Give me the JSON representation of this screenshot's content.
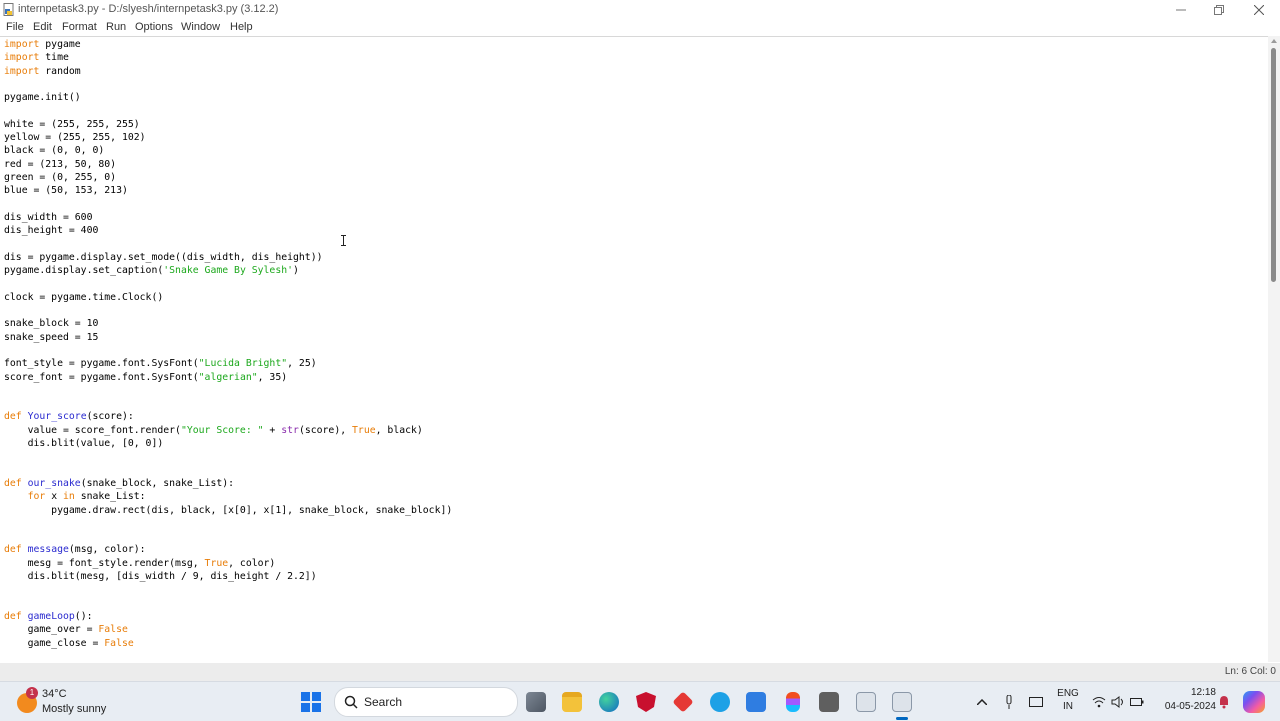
{
  "window": {
    "title": "internpetask3.py - D:/slyesh/internpetask3.py (3.12.2)"
  },
  "menu": [
    "File",
    "Edit",
    "Format",
    "Run",
    "Options",
    "Window",
    "Help"
  ],
  "code_lines": [
    "import pygame",
    "import time",
    "import random",
    "",
    "pygame.init()",
    "",
    "white = (255, 255, 255)",
    "yellow = (255, 255, 102)",
    "black = (0, 0, 0)",
    "red = (213, 50, 80)",
    "green = (0, 255, 0)",
    "blue = (50, 153, 213)",
    "",
    "dis_width = 600",
    "dis_height = 400",
    "",
    "dis = pygame.display.set_mode((dis_width, dis_height))",
    "pygame.display.set_caption('Snake Game By Sylesh')",
    "",
    "clock = pygame.time.Clock()",
    "",
    "snake_block = 10",
    "snake_speed = 15",
    "",
    "font_style = pygame.font.SysFont(\"Lucida Bright\", 25)",
    "score_font = pygame.font.SysFont(\"algerian\", 35)",
    "",
    "",
    "def Your_score(score):",
    "    value = score_font.render(\"Your Score: \" + str(score), True, black)",
    "    dis.blit(value, [0, 0])",
    "",
    "",
    "def our_snake(snake_block, snake_List):",
    "    for x in snake_List:",
    "        pygame.draw.rect(dis, black, [x[0], x[1], snake_block, snake_block])",
    "",
    "",
    "def message(msg, color):",
    "    mesg = font_style.render(msg, True, color)",
    "    dis.blit(mesg, [dis_width / 9, dis_height / 2.2])",
    "",
    "",
    "def gameLoop():",
    "    game_over = False",
    "    game_close = False"
  ],
  "status": {
    "position": "Ln: 6   Col: 0"
  },
  "taskbar": {
    "weather_temp": "34°C",
    "weather_desc": "Mostly sunny",
    "weather_badge": "1",
    "search_label": "Search",
    "lang_top": "ENG",
    "lang_bottom": "IN",
    "time": "12:18",
    "date": "04-05-2024"
  },
  "colors": {
    "keyword": "#e87d09",
    "definition": "#2a2acf",
    "string": "#1ca81c",
    "builtin": "#8a2dad"
  }
}
